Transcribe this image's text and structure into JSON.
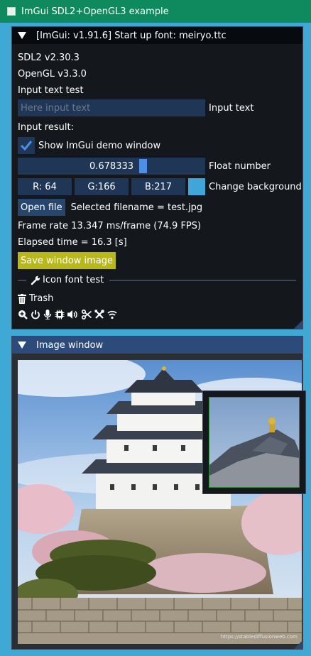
{
  "app": {
    "title": "ImGui SDL2+OpenGL3 example"
  },
  "main": {
    "title": "[ImGui: v1.91.6] Start up font: meiryo.ttc",
    "sdl_version": "SDL2 v2.30.3",
    "gl_version": "OpenGL v3.3.0",
    "input_test_label": "Input text test",
    "input_placeholder": "Here input text",
    "input_value": "",
    "input_field_label": "Input text",
    "input_result_label": "Input result:",
    "demo_checkbox_label": "Show ImGui demo window",
    "demo_checked": true,
    "float_value": "0.678333",
    "float_fraction": 0.678333,
    "float_label": "Float number",
    "color": {
      "r": "R: 64",
      "g": "G:166",
      "b": "B:217",
      "swatch": "#40a6d9",
      "label": "Change background"
    },
    "open_file_label": "Open file",
    "selected_filename": "Selected filename = test.jpg",
    "frame_rate": "Frame rate  13.347 ms/frame (74.9 FPS)",
    "elapsed_time": "Elapsed time = 16.3 [s]",
    "save_button_label": "Save window image",
    "icon_font_header": "Icon font test",
    "trash_label": "Trash",
    "icons": [
      "search-plus-icon",
      "power-icon",
      "microphone-icon",
      "cpu-icon",
      "volume-icon",
      "scissors-icon",
      "tools-icon",
      "wifi-icon"
    ]
  },
  "image_window": {
    "title": "Image window",
    "watermark": "https://stablediffusionweb.com"
  },
  "colors": {
    "background": "#40a8d4",
    "titlebar": "#0f8a5f",
    "window_bg": "#14171c",
    "frame_bg": "#1f3656",
    "button_bg": "#27466e",
    "accent": "#4d8fe6",
    "save_button": "#b8b81a"
  }
}
